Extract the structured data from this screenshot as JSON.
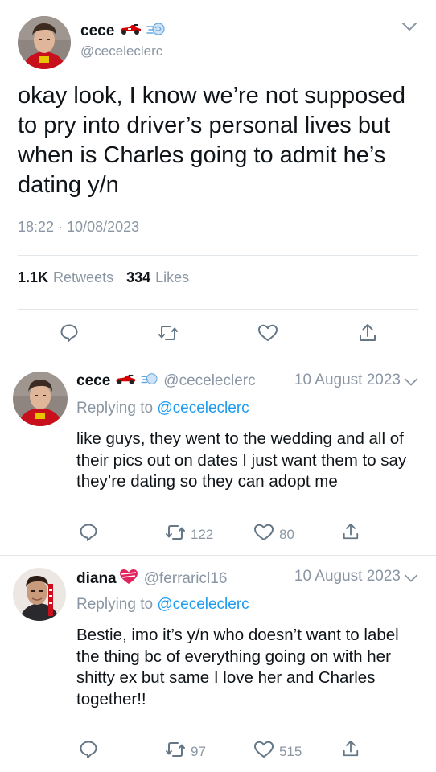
{
  "main_tweet": {
    "author_name": "cece",
    "author_emoji": "🏎💨",
    "handle": "@ceceleclerc",
    "text": "okay look, I know we’re not supposed to pry into driver’s personal lives but when is Charles going to admit he’s dating y/n",
    "timestamp": "18:22 · 10/08/2023",
    "retweets_count": "1.1K",
    "retweets_label": "Retweets",
    "likes_count": "334",
    "likes_label": "Likes"
  },
  "replies": [
    {
      "author_name": "cece",
      "handle": "@ceceleclerc",
      "date": "10 August 2023",
      "replying_prefix": "Replying to",
      "replying_to": "@ceceleclerc",
      "text": "like guys, they went to the wedding and all of their pics out on dates I just want them to say they’re dating so they can adopt me",
      "retweets": "122",
      "likes": "80"
    },
    {
      "author_name": "diana",
      "handle": "@ferraricl16",
      "date": "10 August 2023",
      "replying_prefix": "Replying to",
      "replying_to": "@ceceleclerc",
      "text": "Bestie, imo it’s y/n who doesn’t want to label the thing bc of everything going on with her shitty ex but same I love her and Charles together!!",
      "retweets": "97",
      "likes": "515"
    }
  ],
  "icons": {
    "reply": "reply-bubble-icon",
    "retweet": "retweet-icon",
    "like": "heart-icon",
    "share": "share-icon",
    "more": "chevron-down-icon",
    "race_car": "race-car-emoji",
    "dash": "dash-emoji",
    "heart_emoji": "heart-emoji"
  },
  "colors": {
    "text": "#0f1419",
    "secondary": "#8a96a3",
    "link": "#1d9bf0",
    "divider": "#e1e6ea",
    "ferrari_red": "#d40000"
  }
}
